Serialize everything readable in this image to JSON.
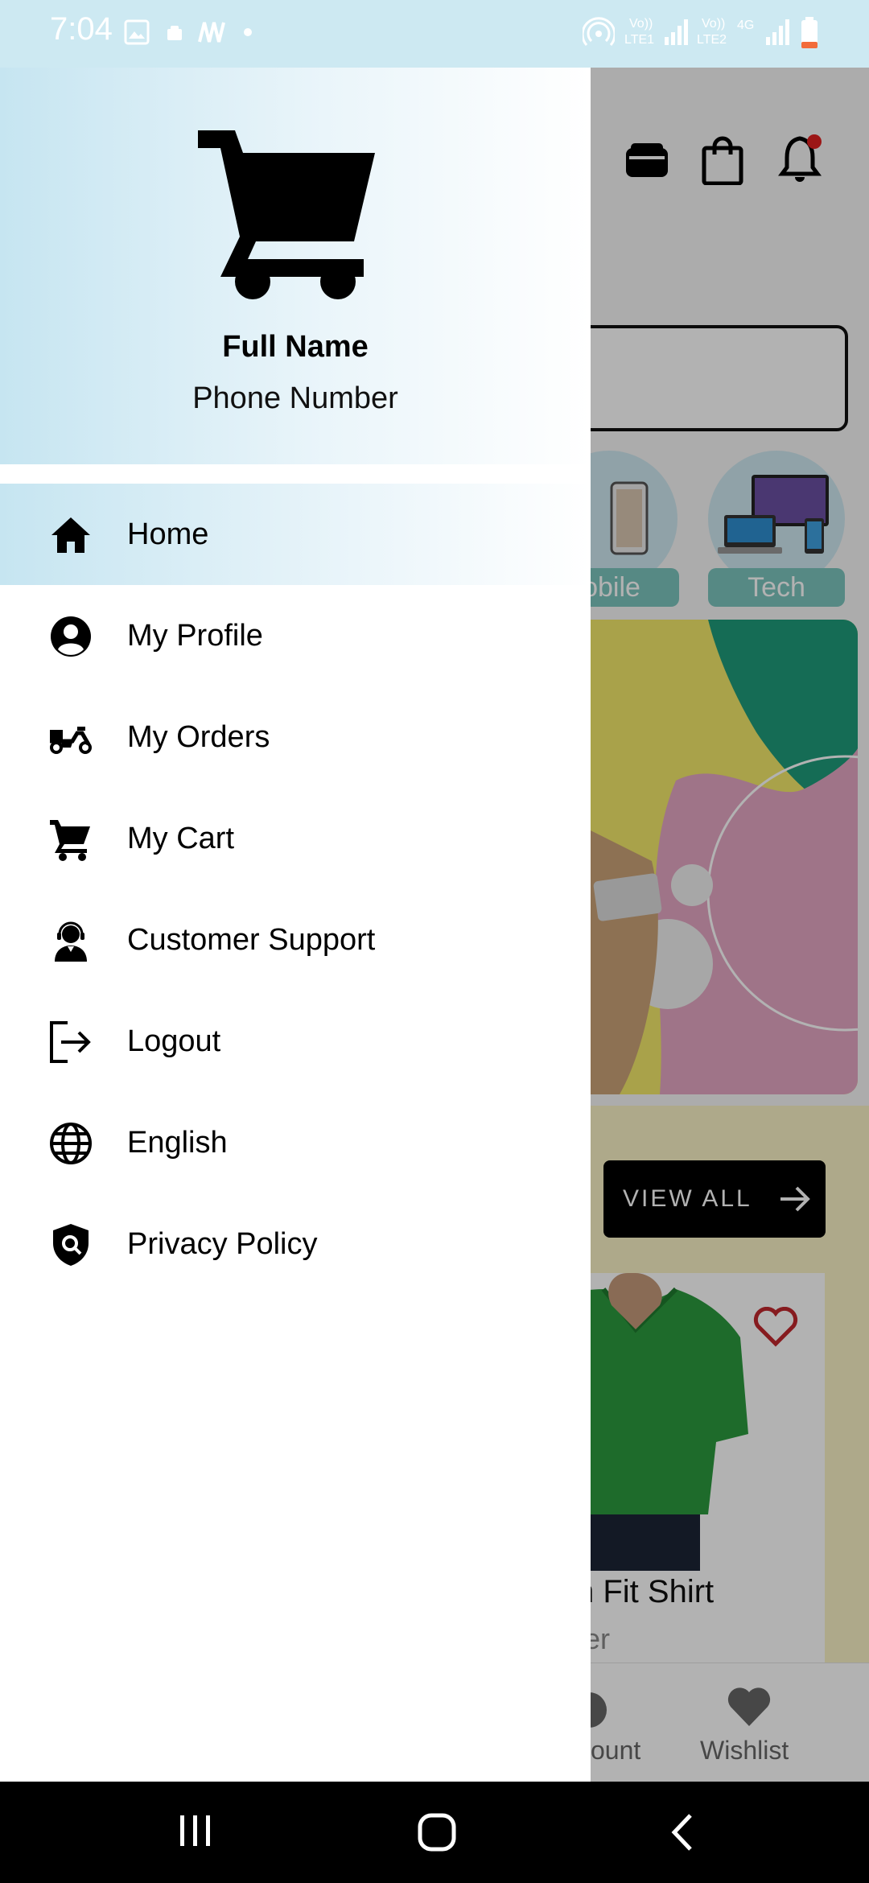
{
  "status_bar": {
    "time": "7:04",
    "sim1_label": "Vo))",
    "sim1_sub": "LTE1",
    "sim2_label": "Vo))",
    "sim2_sub": "LTE2",
    "network": "4G"
  },
  "drawer": {
    "header": {
      "icon": "shopping-cart-icon",
      "full_name": "Full Name",
      "phone_number": "Phone Number"
    },
    "menu": [
      {
        "label": "Home",
        "icon": "home-icon",
        "active": true
      },
      {
        "label": "My Profile",
        "icon": "account-circle-icon",
        "active": false
      },
      {
        "label": "My Orders",
        "icon": "delivery-scooter-icon",
        "active": false
      },
      {
        "label": "My Cart",
        "icon": "cart-icon",
        "active": false
      },
      {
        "label": "Customer Support",
        "icon": "support-agent-icon",
        "active": false
      },
      {
        "label": "Logout",
        "icon": "logout-icon",
        "active": false
      },
      {
        "label": "English",
        "icon": "globe-icon",
        "active": false
      },
      {
        "label": "Privacy Policy",
        "icon": "privacy-shield-icon",
        "active": false
      }
    ]
  },
  "background_app": {
    "categories": [
      {
        "label": "obile"
      },
      {
        "label": "Tech"
      }
    ],
    "view_all_label": "VIEW ALL",
    "product": {
      "name": "n Fit Shirt",
      "subtitle": "ter"
    },
    "bottom_nav": [
      {
        "label": "ount"
      },
      {
        "label": "Wishlist"
      }
    ]
  },
  "colors": {
    "status_bar": "#cde9f2",
    "drawer_header_start": "#c6e5f1",
    "active_item_start": "#c6e5f1",
    "category_label": "#7cc4bd",
    "banner_yellow": "#f2e86a",
    "system_nav": "#000000"
  }
}
